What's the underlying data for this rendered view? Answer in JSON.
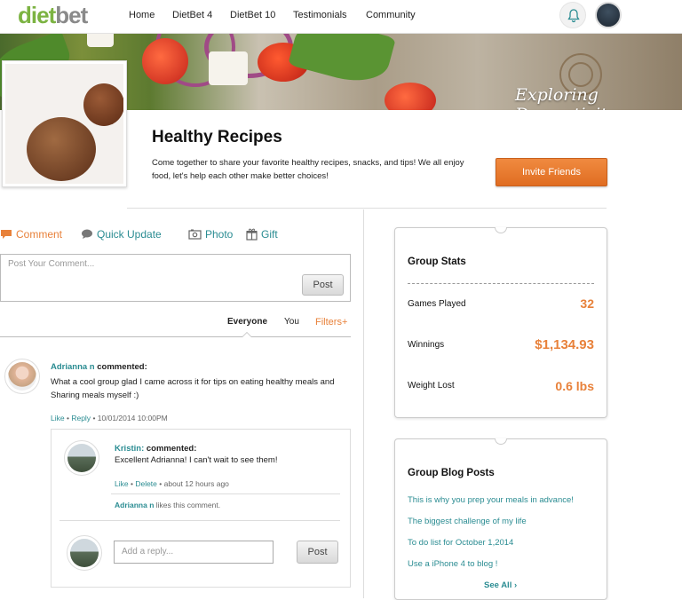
{
  "nav": {
    "logo_diet": "diet",
    "logo_bet": "bet",
    "links": [
      "Home",
      "DietBet 4",
      "DietBet 10",
      "Testimonials",
      "Community"
    ]
  },
  "banner": {
    "script_text": "Exploring Domesticity"
  },
  "group": {
    "title": "Healthy Recipes",
    "description": "Come together to share your favorite healthy recipes, snacks, and tips! We all enjoy food, let's help each other make better choices!",
    "invite_label": "Invite Friends"
  },
  "composer": {
    "tabs": [
      {
        "label": "Comment",
        "icon": "comment-icon"
      },
      {
        "label": "Quick Update",
        "icon": "speech-bubble-icon"
      },
      {
        "label": "Photo",
        "icon": "photo-icon"
      },
      {
        "label": "Gift",
        "icon": "gift-icon"
      }
    ],
    "placeholder": "Post Your Comment...",
    "post_label": "Post"
  },
  "filters": {
    "everyone": "Everyone",
    "you": "You",
    "filters": "Filters+"
  },
  "comment": {
    "author": "Adrianna n",
    "action": "commented:",
    "text": "What a cool group glad I came across it for tips on eating healthy meals and Sharing meals myself :)",
    "like": "Like",
    "reply": "Reply",
    "timestamp": "10/01/2014 10:00PM"
  },
  "reply": {
    "author": "Kristin:",
    "action": "commented:",
    "text": "Excellent Adrianna! I can't wait to see them!",
    "like": "Like",
    "delete": "Delete",
    "timestamp": "about 12 hours ago",
    "likes_name": "Adrianna n",
    "likes_text": "likes this comment.",
    "reply_placeholder": "Add a reply...",
    "post_label": "Post"
  },
  "stats": {
    "title": "Group Stats",
    "rows": [
      {
        "label": "Games Played",
        "value": "32"
      },
      {
        "label": "Winnings",
        "value": "$1,134.93"
      },
      {
        "label": "Weight Lost",
        "value": "0.6 lbs"
      }
    ]
  },
  "blog": {
    "title": "Group Blog Posts",
    "posts": [
      "This is why you prep your meals in advance!",
      "The biggest challenge of my life",
      "To do list for October 1,2014",
      "Use a iPhone 4 to blog !"
    ],
    "see_all": "See All ›"
  },
  "colors": {
    "accent": "#e8813a",
    "link": "#2a8c92",
    "brand": "#7cb342"
  }
}
